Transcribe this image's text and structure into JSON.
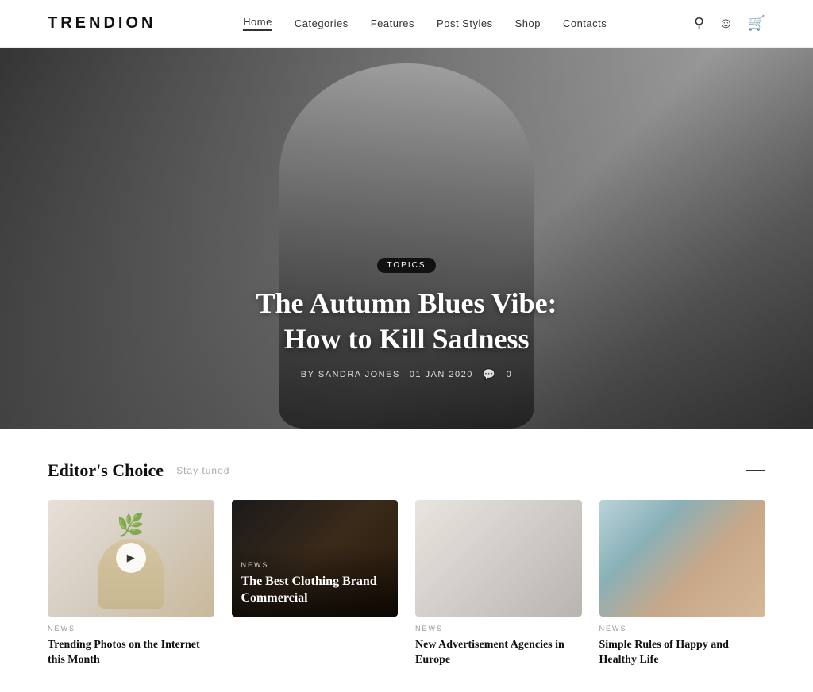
{
  "header": {
    "logo": "TRENDION",
    "nav": {
      "items": [
        {
          "label": "Home",
          "active": true
        },
        {
          "label": "Categories",
          "active": false
        },
        {
          "label": "Features",
          "active": false
        },
        {
          "label": "Post Styles",
          "active": false
        },
        {
          "label": "Shop",
          "active": false
        },
        {
          "label": "Contacts",
          "active": false
        }
      ]
    }
  },
  "hero": {
    "badge": "TOPICS",
    "title": "The Autumn Blues Vibe:\nHow to Kill Sadness",
    "author": "BY SANDRA JONES",
    "date": "01 JAN 2020",
    "comments": "0"
  },
  "editors_choice": {
    "title": "Editor's Choice",
    "subtitle": "Stay tuned"
  },
  "cards": [
    {
      "badge": "NEWS",
      "title": "Trending Photos on the Internet this Month",
      "has_play": true,
      "overlay": false
    },
    {
      "badge": "NEWS",
      "title": "The Best Clothing Brand Commercial",
      "has_play": false,
      "overlay": true
    },
    {
      "badge": "NEWS",
      "title": "New Advertisement Agencies in Europe",
      "has_play": false,
      "overlay": false
    },
    {
      "badge": "NEWS",
      "title": "Simple Rules of Happy and Healthy Life",
      "has_play": false,
      "overlay": false
    }
  ]
}
